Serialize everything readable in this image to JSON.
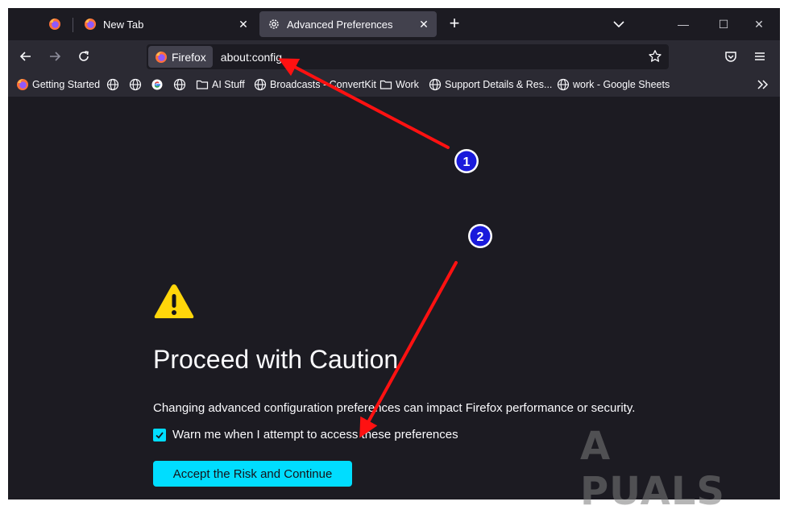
{
  "colors": {
    "accent": "#00ddff",
    "annotation_red": "#ff1111",
    "badge_blue": "#1a1adb",
    "warning_yellow": "#ffd60a"
  },
  "tabs": {
    "pinned_icon": "firefox-logo",
    "new_tab": {
      "label": "New Tab",
      "icon": "firefox-logo"
    },
    "active_tab": {
      "label": "Advanced Preferences",
      "icon": "gear-icon"
    }
  },
  "urlbar": {
    "identity_label": "Firefox",
    "url": "about:config"
  },
  "bookmarks": [
    {
      "label": "Getting Started",
      "icon": "firefox-logo"
    },
    {
      "label": "",
      "icon": "globe-icon"
    },
    {
      "label": "",
      "icon": "globe-icon"
    },
    {
      "label": "",
      "icon": "google-icon"
    },
    {
      "label": "",
      "icon": "globe-icon"
    },
    {
      "label": "AI Stuff",
      "icon": "folder-icon"
    },
    {
      "label": "Broadcasts - ConvertKit",
      "icon": "globe-icon"
    },
    {
      "label": "Work",
      "icon": "folder-icon"
    },
    {
      "label": "Support Details & Res...",
      "icon": "globe-icon"
    },
    {
      "label": "work - Google Sheets",
      "icon": "globe-icon"
    }
  ],
  "content": {
    "heading": "Proceed with Caution",
    "description": "Changing advanced configuration preferences can impact Firefox performance or security.",
    "checkbox_label": "Warn me when I attempt to access these preferences",
    "checkbox_checked": true,
    "accept_button": "Accept the Risk and Continue"
  },
  "annotations": {
    "badge_1": "1",
    "badge_2": "2"
  },
  "watermark": "APPUALS"
}
